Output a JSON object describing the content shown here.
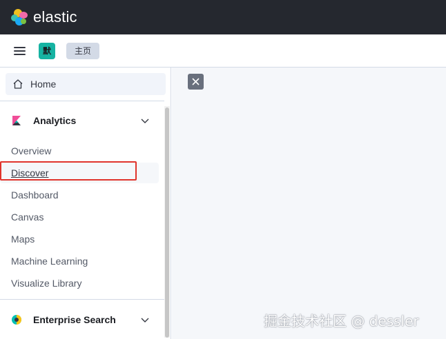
{
  "brand": {
    "name": "elastic"
  },
  "header": {
    "space_initial": "默",
    "breadcrumb": "主页",
    "menu_icon": "hamburger-icon"
  },
  "sidenav": {
    "home": {
      "label": "Home",
      "icon": "home-icon"
    },
    "analytics": {
      "title": "Analytics",
      "icon": "kibana-icon",
      "expanded": true,
      "items": [
        {
          "label": "Overview"
        },
        {
          "label": "Discover",
          "active": true
        },
        {
          "label": "Dashboard"
        },
        {
          "label": "Canvas"
        },
        {
          "label": "Maps"
        },
        {
          "label": "Machine Learning"
        },
        {
          "label": "Visualize Library"
        }
      ]
    },
    "enterprise_search": {
      "title": "Enterprise Search",
      "icon": "enterprise-search-icon"
    }
  },
  "main": {
    "close_icon": "close-icon"
  },
  "watermark": "掘金技术社区 @ dessler",
  "colors": {
    "topbar": "#25282f",
    "accent_teal": "#16b3a2",
    "highlight_red": "#e0332b",
    "content_bg": "#f5f7fa"
  }
}
